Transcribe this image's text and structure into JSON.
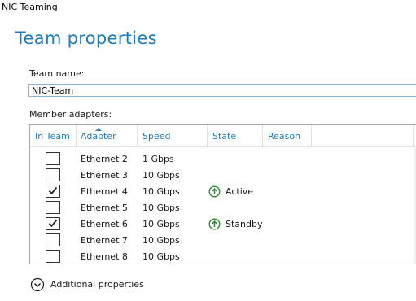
{
  "window": {
    "title": "NIC Teaming"
  },
  "page": {
    "title": "Team properties"
  },
  "team_name": {
    "label": "Team name:",
    "value": "NIC-Team"
  },
  "member_adapters": {
    "label": "Member adapters:",
    "columns": [
      "In Team",
      "Adapter",
      "Speed",
      "State",
      "Reason"
    ],
    "sorted_column": "Adapter",
    "rows": [
      {
        "in_team": false,
        "adapter": "Ethernet 2",
        "speed": "1 Gbps",
        "state": "",
        "reason": ""
      },
      {
        "in_team": false,
        "adapter": "Ethernet 3",
        "speed": "10 Gbps",
        "state": "",
        "reason": ""
      },
      {
        "in_team": true,
        "adapter": "Ethernet 4",
        "speed": "10 Gbps",
        "state": "Active",
        "reason": ""
      },
      {
        "in_team": false,
        "adapter": "Ethernet 5",
        "speed": "10 Gbps",
        "state": "",
        "reason": ""
      },
      {
        "in_team": true,
        "adapter": "Ethernet 6",
        "speed": "10 Gbps",
        "state": "Standby",
        "reason": ""
      },
      {
        "in_team": false,
        "adapter": "Ethernet 7",
        "speed": "10 Gbps",
        "state": "",
        "reason": ""
      },
      {
        "in_team": false,
        "adapter": "Ethernet 8",
        "speed": "10 Gbps",
        "state": "",
        "reason": ""
      }
    ]
  },
  "additional_properties": {
    "label": "Additional properties",
    "icon": "chevron-down-circle-icon"
  },
  "colors": {
    "accent": "#1f7ab8",
    "column_header": "#1f7ab8",
    "state_ok": "#2e8b2e"
  }
}
